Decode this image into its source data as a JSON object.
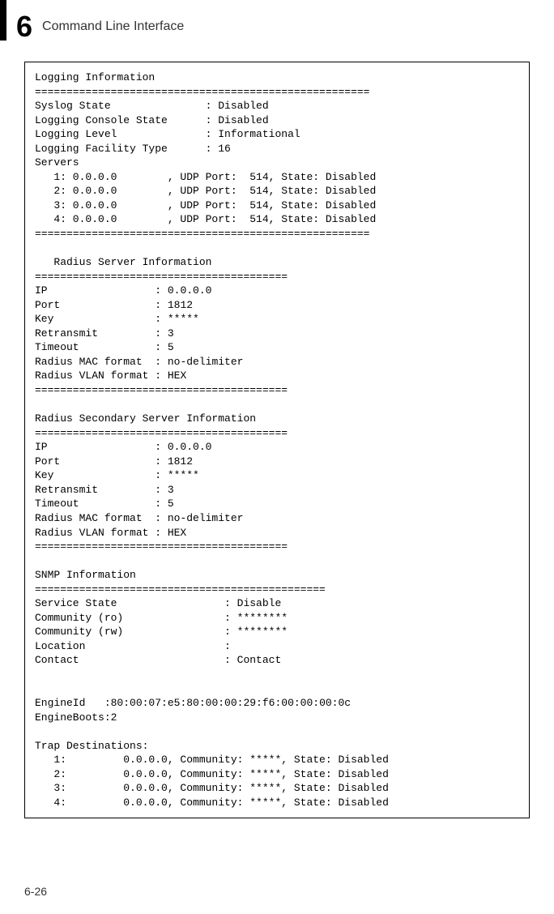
{
  "header": {
    "chapter": "6",
    "title": "Command Line Interface"
  },
  "terminal": {
    "logging_header": "Logging Information",
    "divider1": "=====================================================",
    "syslog_state_label": "Syslog State",
    "syslog_state_value": "Disabled",
    "console_state_label": "Logging Console State",
    "console_state_value": "Disabled",
    "logging_level_label": "Logging Level",
    "logging_level_value": "Informational",
    "facility_type_label": "Logging Facility Type",
    "facility_type_value": "16",
    "servers_label": "Servers",
    "server1": "   1: 0.0.0.0        , UDP Port:  514, State: Disabled",
    "server2": "   2: 0.0.0.0        , UDP Port:  514, State: Disabled",
    "server3": "   3: 0.0.0.0        , UDP Port:  514, State: Disabled",
    "server4": "   4: 0.0.0.0        , UDP Port:  514, State: Disabled",
    "divider2": "=====================================================",
    "radius_header": "   Radius Server Information",
    "divider3": "========================================",
    "ip1_label": "IP",
    "ip1_value": "0.0.0.0",
    "port1_label": "Port",
    "port1_value": "1812",
    "key1_label": "Key",
    "key1_value": "*****",
    "retransmit1_label": "Retransmit",
    "retransmit1_value": "3",
    "timeout1_label": "Timeout",
    "timeout1_value": "5",
    "mac_format1_label": "Radius MAC format",
    "mac_format1_value": "no-delimiter",
    "vlan_format1_label": "Radius VLAN format",
    "vlan_format1_value": "HEX",
    "divider4": "========================================",
    "radius2_header": "Radius Secondary Server Information",
    "divider5": "========================================",
    "ip2_value": "0.0.0.0",
    "port2_value": "1812",
    "key2_value": "*****",
    "retransmit2_value": "3",
    "timeout2_value": "5",
    "mac_format2_value": "no-delimiter",
    "vlan_format2_value": "HEX",
    "divider6": "========================================",
    "snmp_header": "SNMP Information",
    "divider7": "==============================================",
    "service_state_label": "Service State",
    "service_state_value": "Disable",
    "community_ro_label": "Community (ro)",
    "community_ro_value": "********",
    "community_rw_label": "Community (rw)",
    "community_rw_value": "********",
    "location_label": "Location",
    "location_value": "",
    "contact_label": "Contact",
    "contact_value": "Contact",
    "engineid_label": "EngineId",
    "engineid_value": ":80:00:07:e5:80:00:00:29:f6:00:00:00:0c",
    "engineboots_label": "EngineBoots:2",
    "trap_header": "Trap Destinations:",
    "trap1": "   1:         0.0.0.0, Community: *****, State: Disabled",
    "trap2": "   2:         0.0.0.0, Community: *****, State: Disabled",
    "trap3": "   3:         0.0.0.0, Community: *****, State: Disabled",
    "trap4": "   4:         0.0.0.0, Community: *****, State: Disabled"
  },
  "page_number": "6-26"
}
